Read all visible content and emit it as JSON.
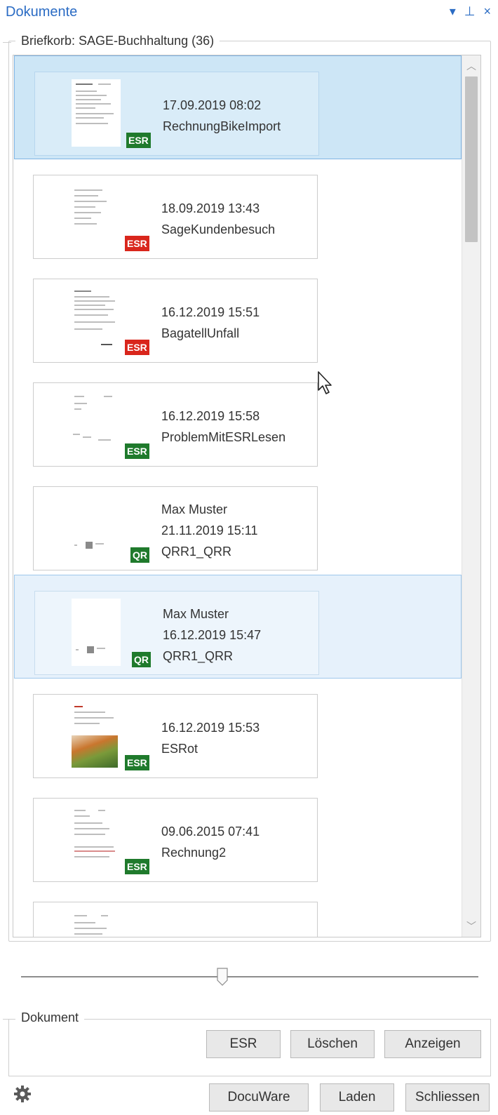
{
  "panel": {
    "title": "Dokumente",
    "controls": [
      "▾",
      "⊥",
      "×"
    ]
  },
  "inbox": {
    "legend": "Briefkorb: SAGE-Buchhaltung (36)",
    "items": [
      {
        "date": "17.09.2019 08:02",
        "name": "RechnungBikeImport",
        "badge": "ESR",
        "badge_color": "#1f7a2c",
        "user": ""
      },
      {
        "date": "18.09.2019 13:43",
        "name": "SageKundenbesuch",
        "badge": "ESR",
        "badge_color": "#d9261c",
        "user": ""
      },
      {
        "date": "16.12.2019 15:51",
        "name": "BagatellUnfall",
        "badge": "ESR",
        "badge_color": "#d9261c",
        "user": ""
      },
      {
        "date": "16.12.2019 15:58",
        "name": "ProblemMitESRLesen",
        "badge": "ESR",
        "badge_color": "#1f7a2c",
        "user": ""
      },
      {
        "user": "Max Muster",
        "date": "21.11.2019 15:11",
        "name": "QRR1_QRR",
        "badge": "QR",
        "badge_color": "#1f7a2c"
      },
      {
        "user": "Max Muster",
        "date": "16.12.2019 15:47",
        "name": "QRR1_QRR",
        "badge": "QR",
        "badge_color": "#1f7a2c"
      },
      {
        "date": "16.12.2019 15:53",
        "name": "ESRot",
        "badge": "ESR",
        "badge_color": "#1f7a2c",
        "user": ""
      },
      {
        "date": "09.06.2015 07:41",
        "name": "Rechnung2",
        "badge": "ESR",
        "badge_color": "#1f7a2c",
        "user": ""
      }
    ]
  },
  "zoom_slider": {
    "value_fraction": 0.44
  },
  "document": {
    "legend": "Dokument",
    "esr_label": "ESR",
    "delete_label": "Löschen",
    "show_label": "Anzeigen"
  },
  "footer": {
    "docuware_label": "DocuWare",
    "load_label": "Laden",
    "close_label": "Schliessen"
  }
}
